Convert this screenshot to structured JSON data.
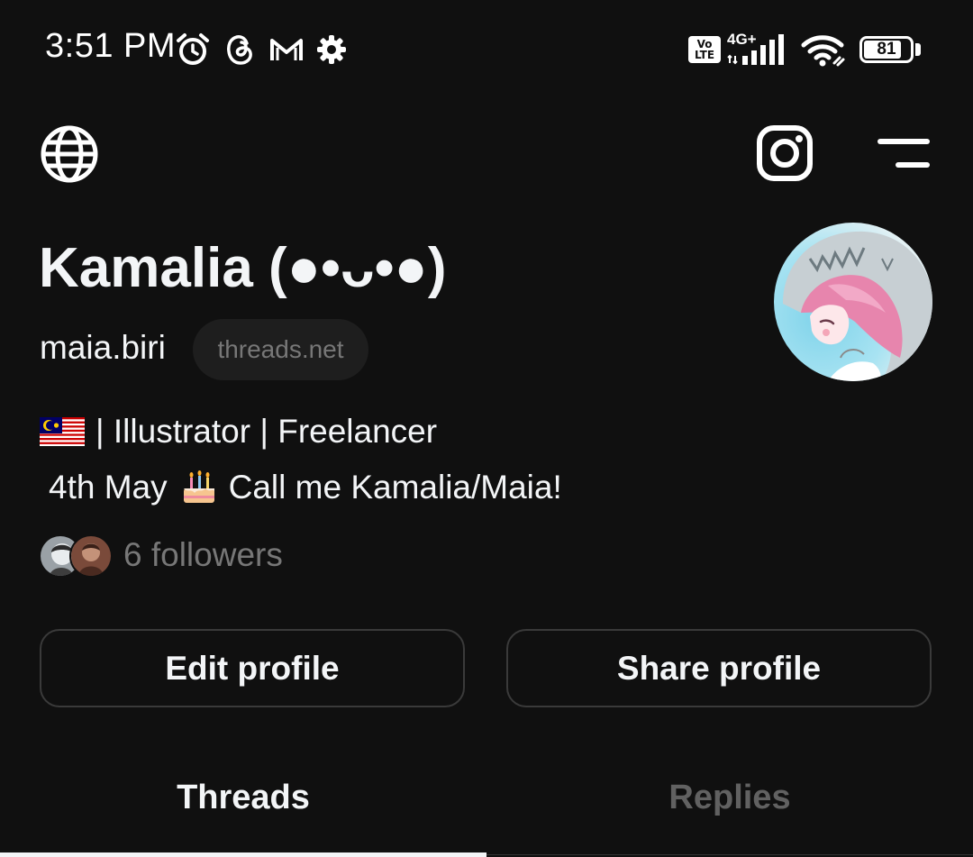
{
  "status_bar": {
    "time": "3:51 PM",
    "left_icons": [
      "alarm-icon",
      "threads-notification-icon",
      "gmail-icon",
      "settings-icon"
    ],
    "volte_label_top": "Vo",
    "volte_label_bottom": "LTE",
    "network_type": "4G+",
    "battery_percent": "81",
    "battery_level": 0.81
  },
  "top_bar": {
    "left_icon": "globe-icon",
    "right_icons": [
      "instagram-icon",
      "menu-icon"
    ]
  },
  "profile": {
    "display_name": "Kamalia (●•ᴗ•●)",
    "username": "maia.biri",
    "domain_badge": "threads.net",
    "avatar": "profile-avatar",
    "bio_line_1": "| Illustrator | Freelancer",
    "bio_line_2_before": "4th May",
    "bio_line_2_after": "Call me Kamalia/Maia!",
    "followers_label": "6 followers"
  },
  "actions": {
    "edit_label": "Edit profile",
    "share_label": "Share profile"
  },
  "tabs": [
    {
      "label": "Threads",
      "active": true
    },
    {
      "label": "Replies",
      "active": false
    }
  ],
  "colors": {
    "background": "#101010",
    "primary_text": "#f3f5f7",
    "secondary_text": "#777777",
    "inactive_tab": "#616161",
    "button_border": "#3a3a3a"
  }
}
